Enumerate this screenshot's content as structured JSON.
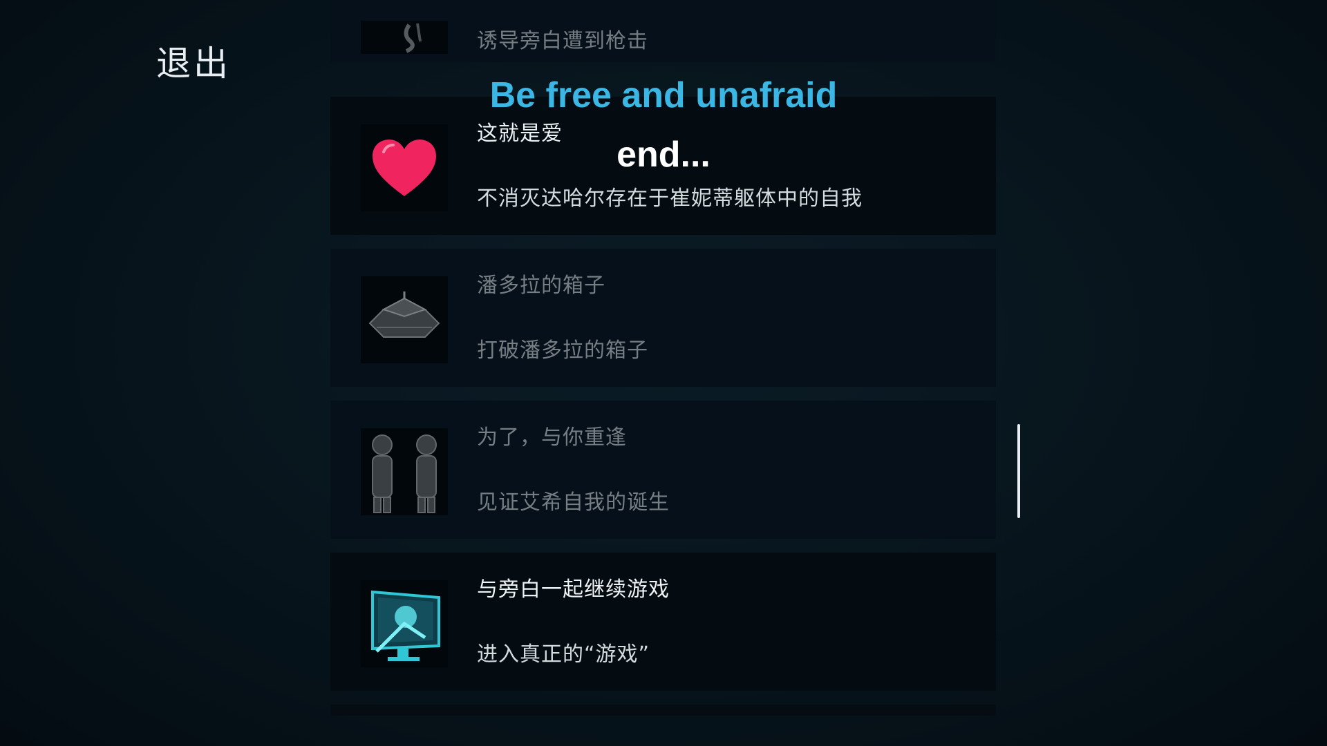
{
  "exit_label": "退出",
  "subtitles": {
    "line1": "Be free and unafraid",
    "line2": "end...",
    "line1_color": "#3bb7e6"
  },
  "achievements": [
    {
      "title": "",
      "desc": "诱导旁白遭到枪击",
      "icon": "figure-icon",
      "unlocked": false
    },
    {
      "title": "这就是爱",
      "desc": "不消灭达哈尔存在于崔妮蒂躯体中的自我",
      "icon": "heart-icon",
      "unlocked": true
    },
    {
      "title": "潘多拉的箱子",
      "desc": "打破潘多拉的箱子",
      "icon": "box-icon",
      "unlocked": false
    },
    {
      "title": "为了，与你重逢",
      "desc": "见证艾希自我的诞生",
      "icon": "statues-icon",
      "unlocked": false
    },
    {
      "title": "与旁白一起继续游戏",
      "desc": "进入真正的“游戏”",
      "icon": "monitor-icon",
      "unlocked": true
    }
  ],
  "colors": {
    "heart": "#f0245e",
    "monitor": "#2fc7d6"
  }
}
